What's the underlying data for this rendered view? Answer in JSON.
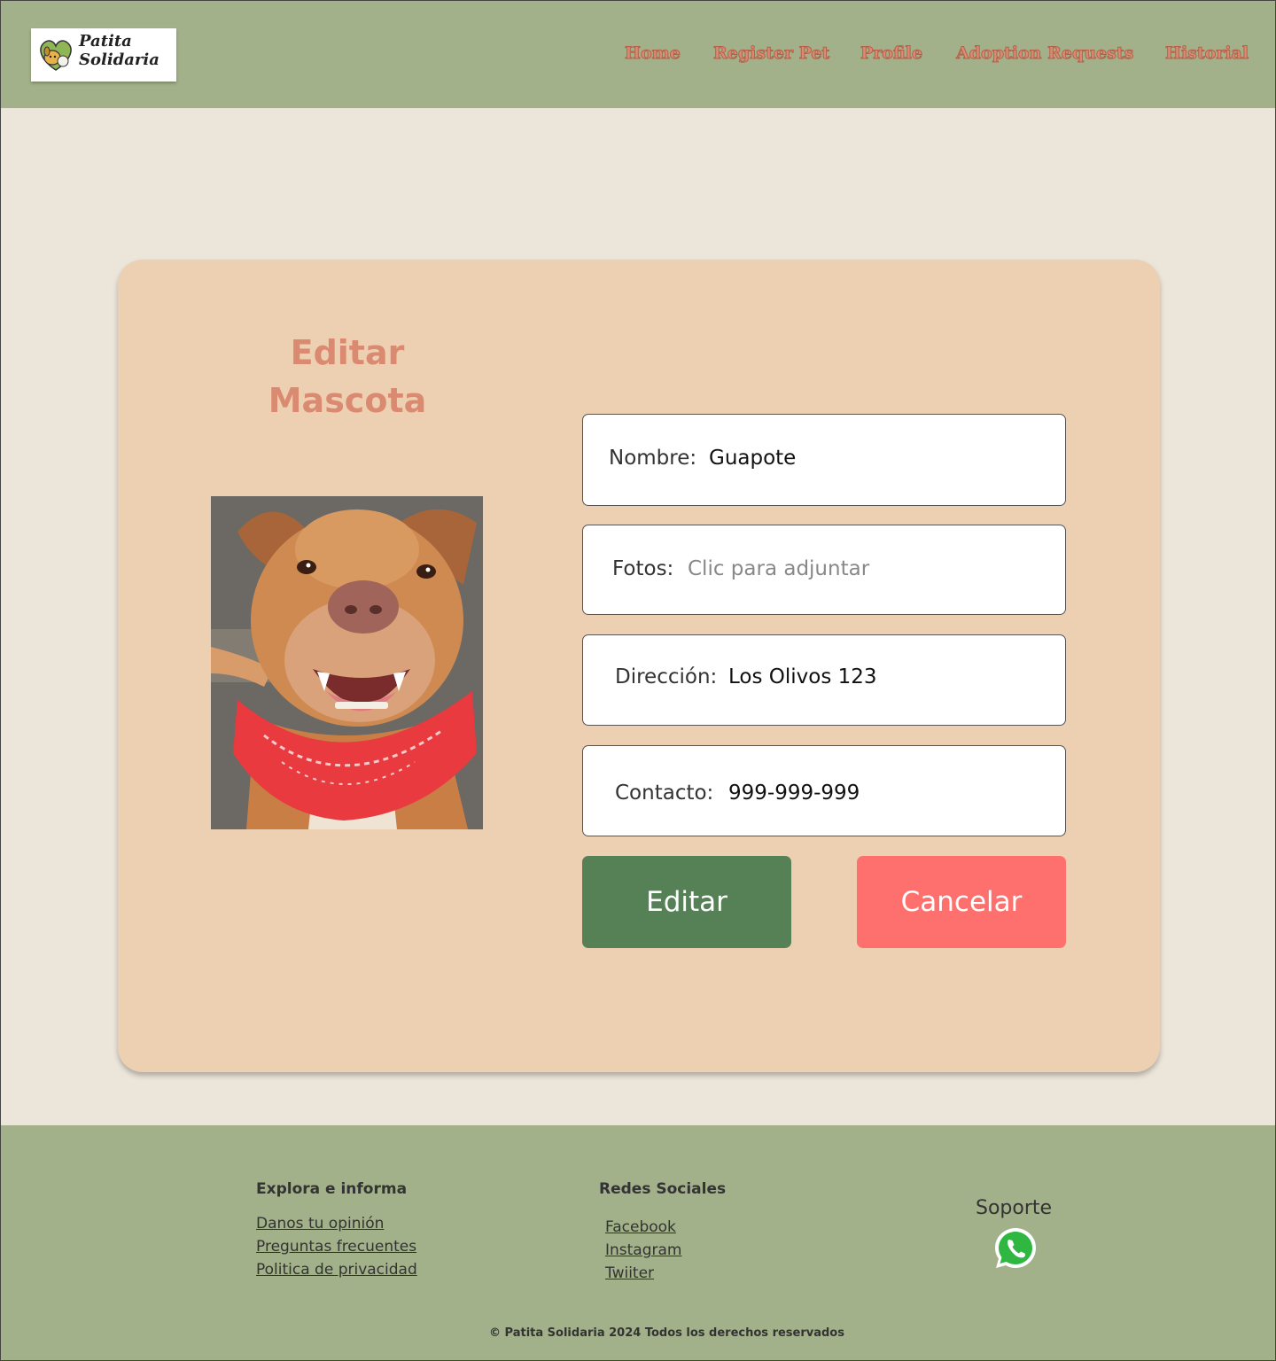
{
  "header": {
    "logo_line1": "Patita",
    "logo_line2": "Solidaria",
    "nav": [
      "Home",
      "Register Pet",
      "Profile",
      "Adoption Requests",
      "Historial"
    ]
  },
  "main": {
    "title_line1": "Editar",
    "title_line2": "Mascota",
    "fields": [
      {
        "label": "Nombre:",
        "value": "Guapote"
      },
      {
        "label": "Fotos:",
        "placeholder": "Clic para adjuntar"
      },
      {
        "label": "Dirección:",
        "value": "Los Olivos 123"
      },
      {
        "label": "Contacto:",
        "value": "999-999-999"
      }
    ],
    "edit_label": "Editar",
    "cancel_label": "Cancelar"
  },
  "footer": {
    "col1": {
      "heading": "Explora e informa",
      "links": [
        "Danos tu opinión",
        "Preguntas frecuentes",
        "Politica de privacidad"
      ]
    },
    "col2": {
      "heading": "Redes Sociales",
      "links": [
        "Facebook",
        "Instagram",
        "Twiiter"
      ]
    },
    "support": "Soporte",
    "copyright": "© Patita Solidaria 2024 Todos los derechos reservados"
  },
  "colors": {
    "header_bg": "#a2b189",
    "page_bg": "#ece5da",
    "card_bg": "#edcfb2",
    "accent": "#d98a70",
    "edit_button": "#568056",
    "cancel_button": "#fe706d"
  },
  "icons": [
    "pet-logo-icon",
    "whatsapp-icon"
  ]
}
